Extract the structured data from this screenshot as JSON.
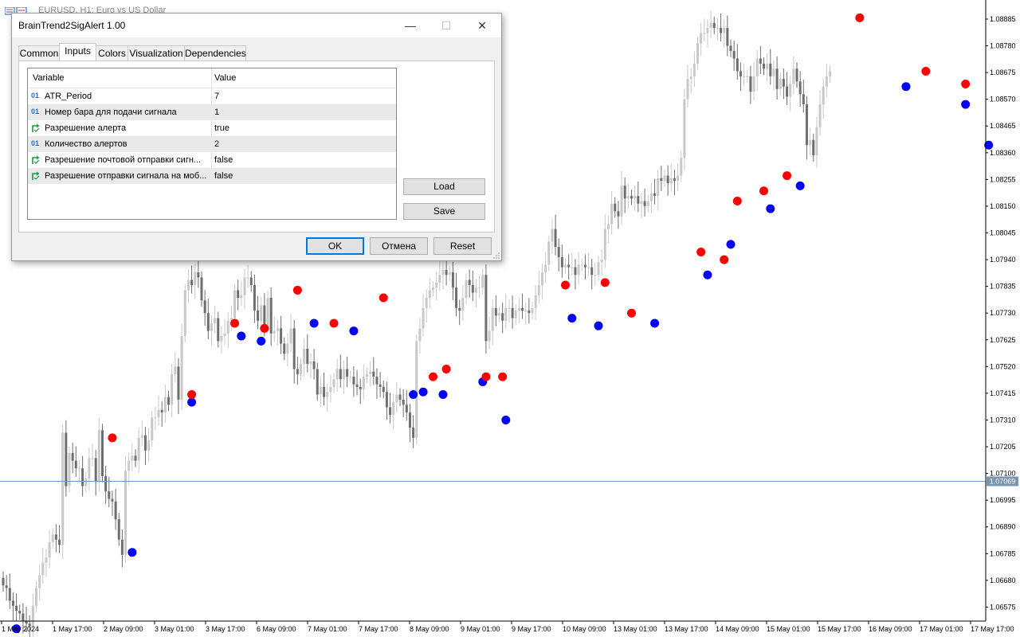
{
  "chart_window": {
    "title": "EURUSD, H1: Euro vs US Dollar"
  },
  "price_axis": {
    "labels": [
      "1.08885",
      "1.08780",
      "1.08675",
      "1.08570",
      "1.08465",
      "1.08360",
      "1.08255",
      "1.08150",
      "1.08045",
      "1.07940",
      "1.07835",
      "1.07730",
      "1.07625",
      "1.07520",
      "1.07415",
      "1.07310",
      "1.07205",
      "1.07100",
      "1.06995",
      "1.06890",
      "1.06785",
      "1.06680",
      "1.06575"
    ],
    "current_price": "1.07069"
  },
  "time_axis": {
    "labels": [
      "1 May 2024",
      "1 May 17:00",
      "2 May 09:00",
      "3 May 01:00",
      "3 May 17:00",
      "6 May 09:00",
      "7 May 01:00",
      "7 May 17:00",
      "8 May 09:00",
      "9 May 01:00",
      "9 May 17:00",
      "10 May 09:00",
      "13 May 01:00",
      "13 May 17:00",
      "14 May 09:00",
      "15 May 01:00",
      "15 May 17:00",
      "16 May 09:00",
      "17 May 01:00",
      "17 May 17:00"
    ]
  },
  "chart_data": {
    "type": "candlestick",
    "symbol": "EURUSD",
    "timeframe": "H1",
    "y_range": [
      1.0652,
      1.0896
    ],
    "current_price": 1.07069,
    "close": [
      1.0666,
      1.0665,
      1.066,
      1.0658,
      1.0656,
      1.0655,
      1.0652,
      1.0651,
      1.065,
      1.0658,
      1.0665,
      1.067,
      1.0675,
      1.0677,
      1.0683,
      1.0686,
      1.0684,
      1.0682,
      1.0726,
      1.0705,
      1.0718,
      1.0715,
      1.0712,
      1.0712,
      1.0705,
      1.0708,
      1.0716,
      1.0716,
      1.0707,
      1.0727,
      1.0709,
      1.0703,
      1.07,
      1.0699,
      1.0692,
      1.0684,
      1.0678,
      1.0711,
      1.0715,
      1.0717,
      1.0715,
      1.0724,
      1.0725,
      1.0719,
      1.0723,
      1.0732,
      1.0732,
      1.0735,
      1.0734,
      1.074,
      1.0737,
      1.0749,
      1.0752,
      1.0739,
      1.0764,
      1.0782,
      1.0786,
      1.0784,
      1.0789,
      1.0787,
      1.0778,
      1.0773,
      1.0766,
      1.0769,
      1.0771,
      1.0762,
      1.0764,
      1.0765,
      1.077,
      1.0771,
      1.0782,
      1.0779,
      1.078,
      1.0787,
      1.0787,
      1.0784,
      1.0774,
      1.077,
      1.0776,
      1.0768,
      1.0779,
      1.0765,
      1.0766,
      1.0767,
      1.0761,
      1.0757,
      1.0761,
      1.0767,
      1.0751,
      1.0749,
      1.0753,
      1.0759,
      1.0753,
      1.0754,
      1.0751,
      1.0741,
      1.0744,
      1.074,
      1.0742,
      1.0744,
      1.0747,
      1.0751,
      1.0747,
      1.0751,
      1.0748,
      1.0748,
      1.0745,
      1.0744,
      1.0743,
      1.0748,
      1.0749,
      1.075,
      1.0748,
      1.0745,
      1.0744,
      1.0742,
      1.0736,
      1.0733,
      1.0738,
      1.0741,
      1.0739,
      1.0737,
      1.0734,
      1.0728,
      1.0724,
      1.0762,
      1.0767,
      1.0775,
      1.0779,
      1.0782,
      1.0783,
      1.0785,
      1.0788,
      1.079,
      1.0788,
      1.0789,
      1.0783,
      1.0775,
      1.0774,
      1.0779,
      1.0786,
      1.0784,
      1.0781,
      1.0783,
      1.0783,
      1.0788,
      1.0762,
      1.0766,
      1.0775,
      1.0772,
      1.0773,
      1.077,
      1.0775,
      1.0775,
      1.0771,
      1.0774,
      1.0775,
      1.0774,
      1.0774,
      1.0773,
      1.0775,
      1.078,
      1.0784,
      1.0789,
      1.0792,
      1.0801,
      1.0806,
      1.0799,
      1.0795,
      1.0791,
      1.0792,
      1.0791,
      1.0791,
      1.0788,
      1.0792,
      1.0792,
      1.0791,
      1.0791,
      1.0788,
      1.0788,
      1.0793,
      1.0794,
      1.0806,
      1.0808,
      1.0816,
      1.0813,
      1.0811,
      1.0823,
      1.0818,
      1.0819,
      1.0818,
      1.0819,
      1.0816,
      1.0817,
      1.0815,
      1.0817,
      1.082,
      1.0819,
      1.0826,
      1.0825,
      1.0827,
      1.0824,
      1.0826,
      1.0825,
      1.0827,
      1.0834,
      1.0857,
      1.0865,
      1.0866,
      1.0871,
      1.0879,
      1.0883,
      1.0883,
      1.0885,
      1.0887,
      1.0885,
      1.0885,
      1.0883,
      1.0885,
      1.0878,
      1.0876,
      1.0873,
      1.0868,
      1.0866,
      1.0866,
      1.0866,
      1.086,
      1.0866,
      1.0873,
      1.0871,
      1.0869,
      1.0871,
      1.0866,
      1.0869,
      1.0861,
      1.0865,
      1.0862,
      1.0858,
      1.0863,
      1.0869,
      1.0864,
      1.0859,
      1.0855,
      1.0839,
      1.0841,
      1.0835,
      1.0846,
      1.0855,
      1.0862,
      1.0866,
      1.0868
    ],
    "buy_signals": [
      {
        "bar": 4,
        "price": 1.0649
      },
      {
        "bar": 39,
        "price": 1.0679
      },
      {
        "bar": 57,
        "price": 1.0738
      },
      {
        "bar": 72,
        "price": 1.0764
      },
      {
        "bar": 78,
        "price": 1.0762
      },
      {
        "bar": 94,
        "price": 1.0769
      },
      {
        "bar": 106,
        "price": 1.0766
      },
      {
        "bar": 124,
        "price": 1.0741
      },
      {
        "bar": 127,
        "price": 1.0742
      },
      {
        "bar": 133,
        "price": 1.0741
      },
      {
        "bar": 145,
        "price": 1.0746
      },
      {
        "bar": 152,
        "price": 1.0731
      },
      {
        "bar": 172,
        "price": 1.0771
      },
      {
        "bar": 180,
        "price": 1.0768
      },
      {
        "bar": 197,
        "price": 1.0769
      },
      {
        "bar": 213,
        "price": 1.0788
      },
      {
        "bar": 220,
        "price": 1.08
      },
      {
        "bar": 232,
        "price": 1.0814
      },
      {
        "bar": 241,
        "price": 1.0823
      },
      {
        "bar": 273,
        "price": 1.0862
      },
      {
        "bar": 291,
        "price": 1.0855
      },
      {
        "bar": 298,
        "price": 1.0839
      }
    ],
    "sell_signals": [
      {
        "bar": 33,
        "price": 1.0724
      },
      {
        "bar": 57,
        "price": 1.0741
      },
      {
        "bar": 70,
        "price": 1.0769
      },
      {
        "bar": 79,
        "price": 1.0767
      },
      {
        "bar": 89,
        "price": 1.0782
      },
      {
        "bar": 100,
        "price": 1.0769
      },
      {
        "bar": 115,
        "price": 1.0779
      },
      {
        "bar": 130,
        "price": 1.0748
      },
      {
        "bar": 134,
        "price": 1.0751
      },
      {
        "bar": 146,
        "price": 1.0748
      },
      {
        "bar": 151,
        "price": 1.0748
      },
      {
        "bar": 170,
        "price": 1.0784
      },
      {
        "bar": 182,
        "price": 1.0785
      },
      {
        "bar": 190,
        "price": 1.0773
      },
      {
        "bar": 211,
        "price": 1.0797
      },
      {
        "bar": 218,
        "price": 1.0794
      },
      {
        "bar": 222,
        "price": 1.0817
      },
      {
        "bar": 230,
        "price": 1.0821
      },
      {
        "bar": 237,
        "price": 1.0827
      },
      {
        "bar": 259,
        "price": 1.0889
      },
      {
        "bar": 279,
        "price": 1.0868
      },
      {
        "bar": 291,
        "price": 1.0863
      }
    ],
    "colors": {
      "bull": "#c8c8c8",
      "bear": "#6e6e6e",
      "buy": "#0000ff",
      "sell": "#ff0000",
      "price_line": "#7a95b0"
    }
  },
  "dialog": {
    "title": "BrainTrend2SigAlert 1.00",
    "tabs": [
      "Common",
      "Inputs",
      "Colors",
      "Visualization",
      "Dependencies"
    ],
    "active_tab": "Inputs",
    "columns": {
      "variable": "Variable",
      "value": "Value"
    },
    "params": [
      {
        "icon": "int-icon",
        "icon_text": "01",
        "name": "ATR_Period",
        "value": "7"
      },
      {
        "icon": "int-icon",
        "icon_text": "01",
        "name": "Номер бара для подачи сигнала",
        "value": "1"
      },
      {
        "icon": "bool-icon",
        "icon_text": "",
        "name": "Разрешение алерта",
        "value": "true"
      },
      {
        "icon": "int-icon",
        "icon_text": "01",
        "name": "Количество алертов",
        "value": "2"
      },
      {
        "icon": "bool-icon",
        "icon_text": "",
        "name": "Разрешение почтовой отправки сигн...",
        "value": "false"
      },
      {
        "icon": "bool-icon",
        "icon_text": "",
        "name": "Разрешение отправки сигнала на моб...",
        "value": "false"
      }
    ],
    "load_label": "Load",
    "save_label": "Save",
    "ok_label": "OK",
    "cancel_label": "Отмена",
    "reset_label": "Reset",
    "minimize_glyph": "—",
    "maximize_glyph": "☐",
    "close_glyph": "✕"
  }
}
